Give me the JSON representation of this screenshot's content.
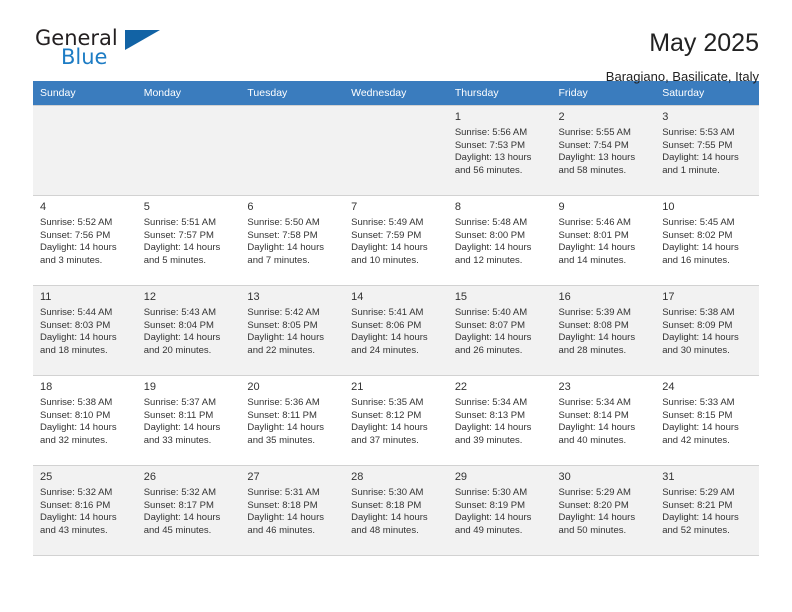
{
  "brand": {
    "name_part1": "General",
    "name_part2": "Blue",
    "triangle_color": "#1263a5",
    "blue_color": "#1d7cc4"
  },
  "header": {
    "title": "May 2025",
    "subtitle": "Baragiano, Basilicate, Italy"
  },
  "theme": {
    "header_row_bg": "#3a7cbe",
    "shaded_row_bg": "#f2f2f2",
    "grid_line": "#d2d2d2"
  },
  "calendar": {
    "weekday_headers": [
      "Sunday",
      "Monday",
      "Tuesday",
      "Wednesday",
      "Thursday",
      "Friday",
      "Saturday"
    ],
    "weeks": [
      {
        "shaded": true,
        "days": [
          {
            "empty": true
          },
          {
            "empty": true
          },
          {
            "empty": true
          },
          {
            "empty": true
          },
          {
            "num": "1",
            "sunrise": "Sunrise: 5:56 AM",
            "sunset": "Sunset: 7:53 PM",
            "daylight": "Daylight: 13 hours and 56 minutes."
          },
          {
            "num": "2",
            "sunrise": "Sunrise: 5:55 AM",
            "sunset": "Sunset: 7:54 PM",
            "daylight": "Daylight: 13 hours and 58 minutes."
          },
          {
            "num": "3",
            "sunrise": "Sunrise: 5:53 AM",
            "sunset": "Sunset: 7:55 PM",
            "daylight": "Daylight: 14 hours and 1 minute."
          }
        ]
      },
      {
        "shaded": false,
        "days": [
          {
            "num": "4",
            "sunrise": "Sunrise: 5:52 AM",
            "sunset": "Sunset: 7:56 PM",
            "daylight": "Daylight: 14 hours and 3 minutes."
          },
          {
            "num": "5",
            "sunrise": "Sunrise: 5:51 AM",
            "sunset": "Sunset: 7:57 PM",
            "daylight": "Daylight: 14 hours and 5 minutes."
          },
          {
            "num": "6",
            "sunrise": "Sunrise: 5:50 AM",
            "sunset": "Sunset: 7:58 PM",
            "daylight": "Daylight: 14 hours and 7 minutes."
          },
          {
            "num": "7",
            "sunrise": "Sunrise: 5:49 AM",
            "sunset": "Sunset: 7:59 PM",
            "daylight": "Daylight: 14 hours and 10 minutes."
          },
          {
            "num": "8",
            "sunrise": "Sunrise: 5:48 AM",
            "sunset": "Sunset: 8:00 PM",
            "daylight": "Daylight: 14 hours and 12 minutes."
          },
          {
            "num": "9",
            "sunrise": "Sunrise: 5:46 AM",
            "sunset": "Sunset: 8:01 PM",
            "daylight": "Daylight: 14 hours and 14 minutes."
          },
          {
            "num": "10",
            "sunrise": "Sunrise: 5:45 AM",
            "sunset": "Sunset: 8:02 PM",
            "daylight": "Daylight: 14 hours and 16 minutes."
          }
        ]
      },
      {
        "shaded": true,
        "days": [
          {
            "num": "11",
            "sunrise": "Sunrise: 5:44 AM",
            "sunset": "Sunset: 8:03 PM",
            "daylight": "Daylight: 14 hours and 18 minutes."
          },
          {
            "num": "12",
            "sunrise": "Sunrise: 5:43 AM",
            "sunset": "Sunset: 8:04 PM",
            "daylight": "Daylight: 14 hours and 20 minutes."
          },
          {
            "num": "13",
            "sunrise": "Sunrise: 5:42 AM",
            "sunset": "Sunset: 8:05 PM",
            "daylight": "Daylight: 14 hours and 22 minutes."
          },
          {
            "num": "14",
            "sunrise": "Sunrise: 5:41 AM",
            "sunset": "Sunset: 8:06 PM",
            "daylight": "Daylight: 14 hours and 24 minutes."
          },
          {
            "num": "15",
            "sunrise": "Sunrise: 5:40 AM",
            "sunset": "Sunset: 8:07 PM",
            "daylight": "Daylight: 14 hours and 26 minutes."
          },
          {
            "num": "16",
            "sunrise": "Sunrise: 5:39 AM",
            "sunset": "Sunset: 8:08 PM",
            "daylight": "Daylight: 14 hours and 28 minutes."
          },
          {
            "num": "17",
            "sunrise": "Sunrise: 5:38 AM",
            "sunset": "Sunset: 8:09 PM",
            "daylight": "Daylight: 14 hours and 30 minutes."
          }
        ]
      },
      {
        "shaded": false,
        "days": [
          {
            "num": "18",
            "sunrise": "Sunrise: 5:38 AM",
            "sunset": "Sunset: 8:10 PM",
            "daylight": "Daylight: 14 hours and 32 minutes."
          },
          {
            "num": "19",
            "sunrise": "Sunrise: 5:37 AM",
            "sunset": "Sunset: 8:11 PM",
            "daylight": "Daylight: 14 hours and 33 minutes."
          },
          {
            "num": "20",
            "sunrise": "Sunrise: 5:36 AM",
            "sunset": "Sunset: 8:11 PM",
            "daylight": "Daylight: 14 hours and 35 minutes."
          },
          {
            "num": "21",
            "sunrise": "Sunrise: 5:35 AM",
            "sunset": "Sunset: 8:12 PM",
            "daylight": "Daylight: 14 hours and 37 minutes."
          },
          {
            "num": "22",
            "sunrise": "Sunrise: 5:34 AM",
            "sunset": "Sunset: 8:13 PM",
            "daylight": "Daylight: 14 hours and 39 minutes."
          },
          {
            "num": "23",
            "sunrise": "Sunrise: 5:34 AM",
            "sunset": "Sunset: 8:14 PM",
            "daylight": "Daylight: 14 hours and 40 minutes."
          },
          {
            "num": "24",
            "sunrise": "Sunrise: 5:33 AM",
            "sunset": "Sunset: 8:15 PM",
            "daylight": "Daylight: 14 hours and 42 minutes."
          }
        ]
      },
      {
        "shaded": true,
        "days": [
          {
            "num": "25",
            "sunrise": "Sunrise: 5:32 AM",
            "sunset": "Sunset: 8:16 PM",
            "daylight": "Daylight: 14 hours and 43 minutes."
          },
          {
            "num": "26",
            "sunrise": "Sunrise: 5:32 AM",
            "sunset": "Sunset: 8:17 PM",
            "daylight": "Daylight: 14 hours and 45 minutes."
          },
          {
            "num": "27",
            "sunrise": "Sunrise: 5:31 AM",
            "sunset": "Sunset: 8:18 PM",
            "daylight": "Daylight: 14 hours and 46 minutes."
          },
          {
            "num": "28",
            "sunrise": "Sunrise: 5:30 AM",
            "sunset": "Sunset: 8:18 PM",
            "daylight": "Daylight: 14 hours and 48 minutes."
          },
          {
            "num": "29",
            "sunrise": "Sunrise: 5:30 AM",
            "sunset": "Sunset: 8:19 PM",
            "daylight": "Daylight: 14 hours and 49 minutes."
          },
          {
            "num": "30",
            "sunrise": "Sunrise: 5:29 AM",
            "sunset": "Sunset: 8:20 PM",
            "daylight": "Daylight: 14 hours and 50 minutes."
          },
          {
            "num": "31",
            "sunrise": "Sunrise: 5:29 AM",
            "sunset": "Sunset: 8:21 PM",
            "daylight": "Daylight: 14 hours and 52 minutes."
          }
        ]
      }
    ]
  }
}
